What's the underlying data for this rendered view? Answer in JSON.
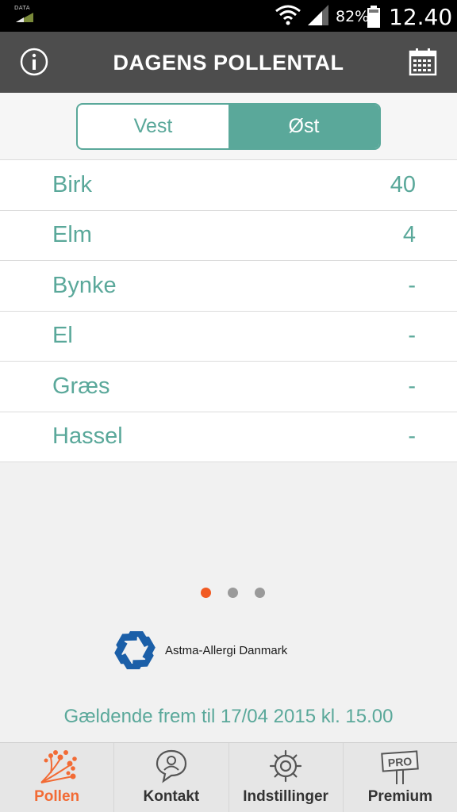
{
  "status_bar": {
    "data_label": "DATA",
    "battery_percent": "82%",
    "time": "12.40"
  },
  "header": {
    "title": "DAGENS POLLENTAL",
    "left_icon": "info-icon",
    "right_icon": "calendar-icon"
  },
  "region_toggle": {
    "options": [
      {
        "label": "Vest",
        "selected": false
      },
      {
        "label": "Øst",
        "selected": true
      }
    ]
  },
  "pollen": [
    {
      "name": "Birk",
      "value": "40"
    },
    {
      "name": "Elm",
      "value": "4"
    },
    {
      "name": "Bynke",
      "value": "-"
    },
    {
      "name": "El",
      "value": "-"
    },
    {
      "name": "Græs",
      "value": "-"
    },
    {
      "name": "Hassel",
      "value": "-"
    }
  ],
  "pager": {
    "count": 3,
    "active_index": 0
  },
  "sponsor": {
    "name": "Astma-Allergi Danmark"
  },
  "validity": "Gældende frem til 17/04 2015 kl. 15.00",
  "tabs": [
    {
      "label": "Pollen",
      "icon": "pollen-icon",
      "active": true
    },
    {
      "label": "Kontakt",
      "icon": "contact-icon",
      "active": false
    },
    {
      "label": "Indstillinger",
      "icon": "gear-icon",
      "active": false
    },
    {
      "label": "Premium",
      "icon": "pro-sign-icon",
      "active": false
    }
  ],
  "colors": {
    "accent": "#5aa89a",
    "header_bg": "#4d4d4d",
    "active_tab": "#f26b35",
    "active_dot": "#f15a22"
  }
}
